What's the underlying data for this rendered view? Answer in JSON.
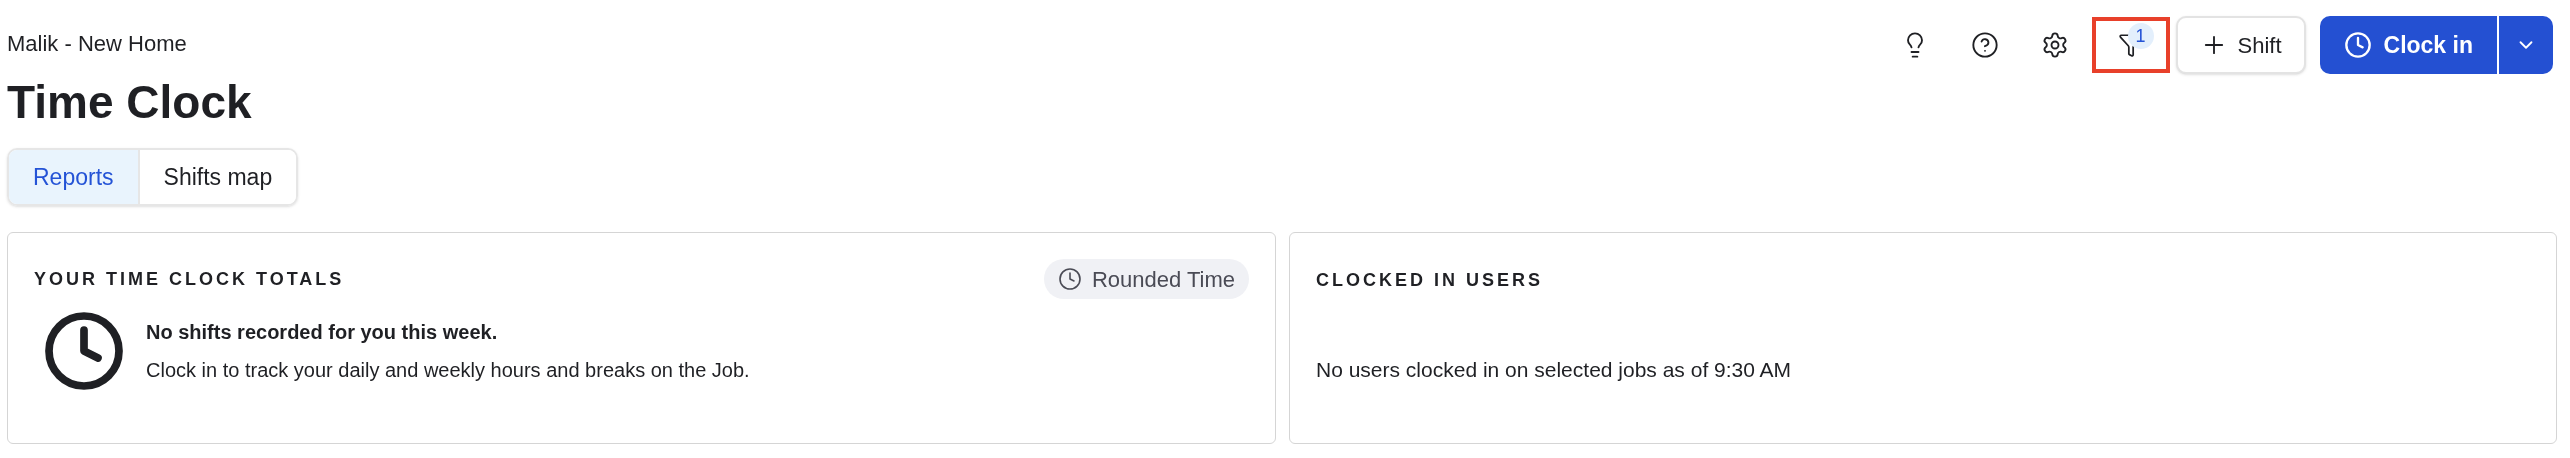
{
  "breadcrumb": "Malik - New Home",
  "title": "Time Clock",
  "toolbar": {
    "filter_badge": "1",
    "filter_highlighted": true,
    "shift_button": "Shift",
    "clock_in_button": "Clock in"
  },
  "tabs": [
    {
      "label": "Reports",
      "selected": true
    },
    {
      "label": "Shifts map",
      "selected": false
    }
  ],
  "totals_card": {
    "heading": "YOUR TIME CLOCK TOTALS",
    "chip": "Rounded Time",
    "message_title": "No shifts recorded for you this week.",
    "message_body": "Clock in to track your daily and weekly hours and breaks on the Job."
  },
  "clocked_in_card": {
    "heading": "CLOCKED IN USERS",
    "message": "No users clocked in on selected jobs as of 9:30 AM"
  }
}
